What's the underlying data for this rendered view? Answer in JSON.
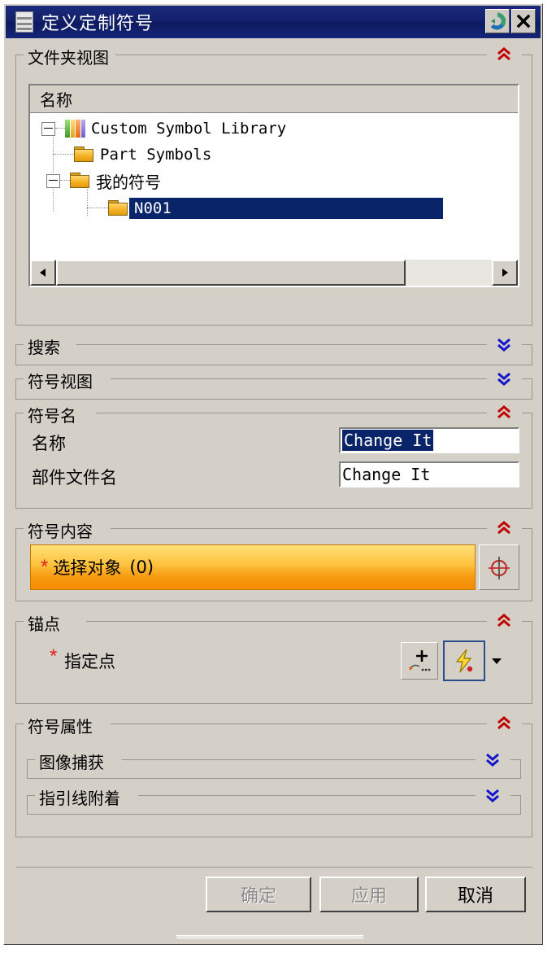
{
  "window": {
    "title": "定义定制符号",
    "menu_icon": "hamburger-menu-icon",
    "reset_icon": "reset-circular-arrow-icon",
    "close_icon": "close-x-icon"
  },
  "folder_view": {
    "title": "文件夹视图",
    "expanded": true,
    "collapse_icon": "chevron-double-up-icon",
    "column_header": "名称",
    "tree": [
      {
        "label": "Custom Symbol Library",
        "icon": "books-library-icon",
        "level": 0,
        "expanded": true,
        "selected": false
      },
      {
        "label": "Part Symbols",
        "icon": "folder-icon",
        "level": 1,
        "expanded": null,
        "selected": false
      },
      {
        "label": "我的符号",
        "icon": "folder-icon",
        "level": 1,
        "expanded": true,
        "selected": false
      },
      {
        "label": "N001",
        "icon": "folder-icon",
        "level": 2,
        "expanded": null,
        "selected": true
      }
    ],
    "scrollbar": {
      "left_arrow_icon": "triangle-left-icon",
      "right_arrow_icon": "triangle-right-icon"
    }
  },
  "search": {
    "title": "搜索",
    "expanded": false,
    "expand_icon": "chevron-double-down-icon"
  },
  "symbol_view": {
    "title": "符号视图",
    "expanded": false,
    "expand_icon": "chevron-double-down-icon"
  },
  "symbol_name": {
    "title": "符号名",
    "expanded": true,
    "collapse_icon": "chevron-double-up-icon",
    "fields": [
      {
        "label": "名称",
        "value": "Change It",
        "selected": true
      },
      {
        "label": "部件文件名",
        "value": "Change It",
        "selected": false
      }
    ]
  },
  "symbol_content": {
    "title": "符号内容",
    "expanded": true,
    "collapse_icon": "chevron-double-up-icon",
    "select_object": {
      "required_marker": "*",
      "label": "选择对象",
      "count": "(0)",
      "icon": "select-target-crosshair-icon"
    }
  },
  "anchor_point": {
    "title": "锚点",
    "expanded": true,
    "collapse_icon": "chevron-double-up-icon",
    "specify_point": {
      "required_marker": "*",
      "label": "指定点",
      "point_constructor_icon": "point-plus-icon",
      "inferred_point_icon": "lightning-bolt-inferred-point-icon",
      "dropdown_icon": "triangle-down-icon"
    }
  },
  "symbol_attributes": {
    "title": "符号属性",
    "expanded": true,
    "collapse_icon": "chevron-double-up-icon",
    "subsections": [
      {
        "title": "图像捕获",
        "expanded": false,
        "expand_icon": "chevron-double-down-icon"
      },
      {
        "title": "指引线附着",
        "expanded": false,
        "expand_icon": "chevron-double-down-icon"
      }
    ]
  },
  "footer": {
    "buttons": [
      {
        "label": "确定",
        "disabled": true
      },
      {
        "label": "应用",
        "disabled": true
      },
      {
        "label": "取消",
        "disabled": false
      }
    ]
  },
  "colors": {
    "dialog_bg": "#d4d0c8",
    "titlebar": "#12206b",
    "selection": "#0a246a",
    "collapse_chevron": "#c00000",
    "expand_chevron": "#1515cc",
    "required_asterisk": "#e02020",
    "select_bar": "#f79d13"
  }
}
